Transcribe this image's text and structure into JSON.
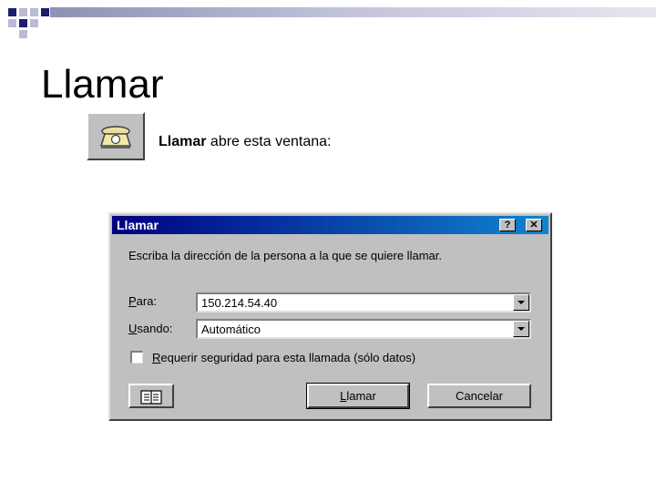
{
  "slide": {
    "title": "Llamar",
    "caption_bold": "Llamar",
    "caption_rest": " abre esta ventana:",
    "toolbar_icon": "telephone-icon"
  },
  "dialog": {
    "title": "Llamar",
    "help_label": "?",
    "close_label": "✕",
    "prompt": "Escriba la dirección de la persona a la que se quiere llamar.",
    "para_label_u": "P",
    "para_label_rest": "ara:",
    "para_value": "150.214.54.40",
    "usando_label_u": "U",
    "usando_label_rest": "sando:",
    "usando_value": "Automático",
    "checkbox_checked": false,
    "checkbox_label_u": "R",
    "checkbox_label_rest": "equerir seguridad para esta llamada (sólo datos)",
    "address_book_icon": "address-book-icon",
    "call_button_u": "L",
    "call_button_rest": "lamar",
    "cancel_button": "Cancelar"
  },
  "colors": {
    "title_bar_start": "#000080",
    "title_bar_end": "#1084d0",
    "dialog_face": "#c0c0c0"
  }
}
